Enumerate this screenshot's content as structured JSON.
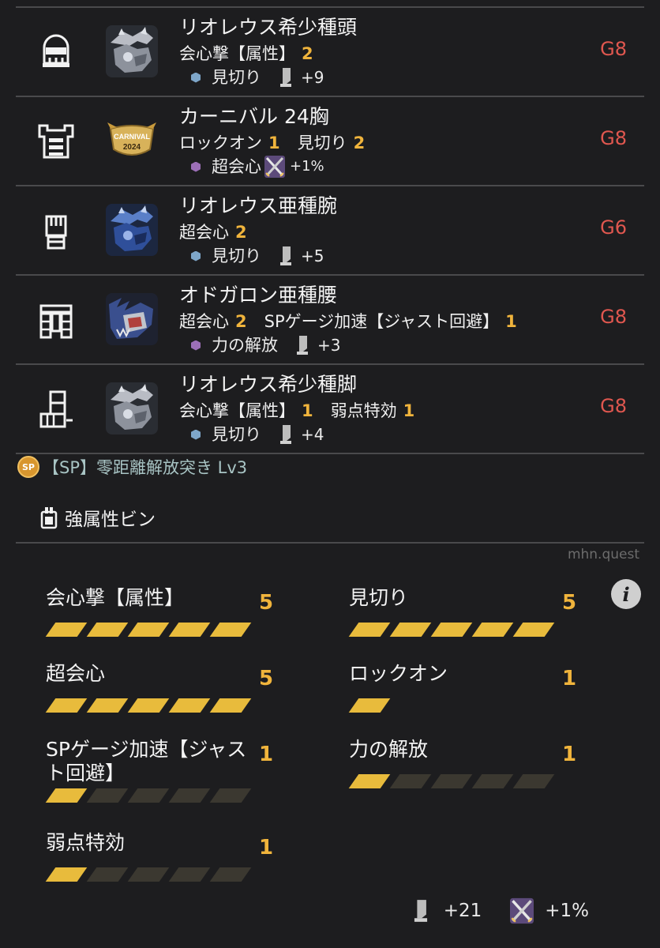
{
  "equipment": [
    {
      "slot": "head",
      "slot_icon": "helmet-icon",
      "monster_icon": "silver-rathalos-icon",
      "name": "リオレウス希少種頭",
      "skills": [
        {
          "name": "会心撃【属性】",
          "level": "2"
        }
      ],
      "gem_color": "blue",
      "gem_skill": "見切り",
      "bonus_icon": "sharpness-icon",
      "bonus": "+9",
      "grade": "G8"
    },
    {
      "slot": "chest",
      "slot_icon": "chest-armor-icon",
      "monster_icon": "carnival-2024-badge-icon",
      "badge_line1": "CARNIVAL",
      "badge_line2": "2024",
      "name": "カーニバル 24胸",
      "skills": [
        {
          "name": "ロックオン",
          "level": "1"
        },
        {
          "name": "見切り",
          "level": "2"
        }
      ],
      "gem_color": "purple",
      "gem_skill": "超会心",
      "bonus_icon": "crossed-swords-icon",
      "bonus": "+1%",
      "grade": "G8"
    },
    {
      "slot": "arms",
      "slot_icon": "gauntlet-icon",
      "monster_icon": "azure-rathalos-icon",
      "name": "リオレウス亜種腕",
      "skills": [
        {
          "name": "超会心",
          "level": "2"
        }
      ],
      "gem_color": "blue",
      "gem_skill": "見切り",
      "bonus_icon": "sharpness-icon",
      "bonus": "+5",
      "grade": "G6"
    },
    {
      "slot": "waist",
      "slot_icon": "waist-armor-icon",
      "monster_icon": "azure-odogaron-icon",
      "name": "オドガロン亜種腰",
      "skills": [
        {
          "name": "超会心",
          "level": "2"
        },
        {
          "name": "SPゲージ加速【ジャスト回避】",
          "level": "1"
        }
      ],
      "gem_color": "purple",
      "gem_skill": "力の解放",
      "bonus_icon": "sharpness-icon",
      "bonus": "+3",
      "grade": "G8"
    },
    {
      "slot": "legs",
      "slot_icon": "greaves-icon",
      "monster_icon": "silver-rathalos-icon",
      "name": "リオレウス希少種脚",
      "skills": [
        {
          "name": "会心撃【属性】",
          "level": "1"
        },
        {
          "name": "弱点特効",
          "level": "1"
        }
      ],
      "gem_color": "blue",
      "gem_skill": "見切り",
      "bonus_icon": "sharpness-icon",
      "bonus": "+4",
      "grade": "G8"
    }
  ],
  "special": {
    "badge": "SP",
    "text": "【SP】零距離解放突き Lv3"
  },
  "coating": {
    "icon": "coating-bottle-icon",
    "text": "強属性ビン"
  },
  "watermark": "mhn.quest",
  "info_icon": "info-icon",
  "skill_summary": [
    {
      "name": "会心撃【属性】",
      "level": 5,
      "level_text": "5",
      "max": 5
    },
    {
      "name": "見切り",
      "level": 5,
      "level_text": "5",
      "max": 5
    },
    {
      "name": "超会心",
      "level": 5,
      "level_text": "5",
      "max": 5
    },
    {
      "name": "ロックオン",
      "level": 1,
      "level_text": "1",
      "max": 1
    },
    {
      "name": "SPゲージ加速【ジャスト回避】",
      "level": 1,
      "level_text": "1",
      "max": 5
    },
    {
      "name": "力の解放",
      "level": 1,
      "level_text": "1",
      "max": 5
    },
    {
      "name": "弱点特効",
      "level": 1,
      "level_text": "1",
      "max": 5
    }
  ],
  "totals": [
    {
      "icon": "sharpness-icon",
      "value": "+21"
    },
    {
      "icon": "crossed-swords-icon",
      "value": "+1%"
    }
  ],
  "colors": {
    "background": "#1d1d1f",
    "level": "#f0b43c",
    "grade": "#e0574f",
    "bar_on": "#e8bb3c",
    "bar_off": "#3b3830"
  }
}
